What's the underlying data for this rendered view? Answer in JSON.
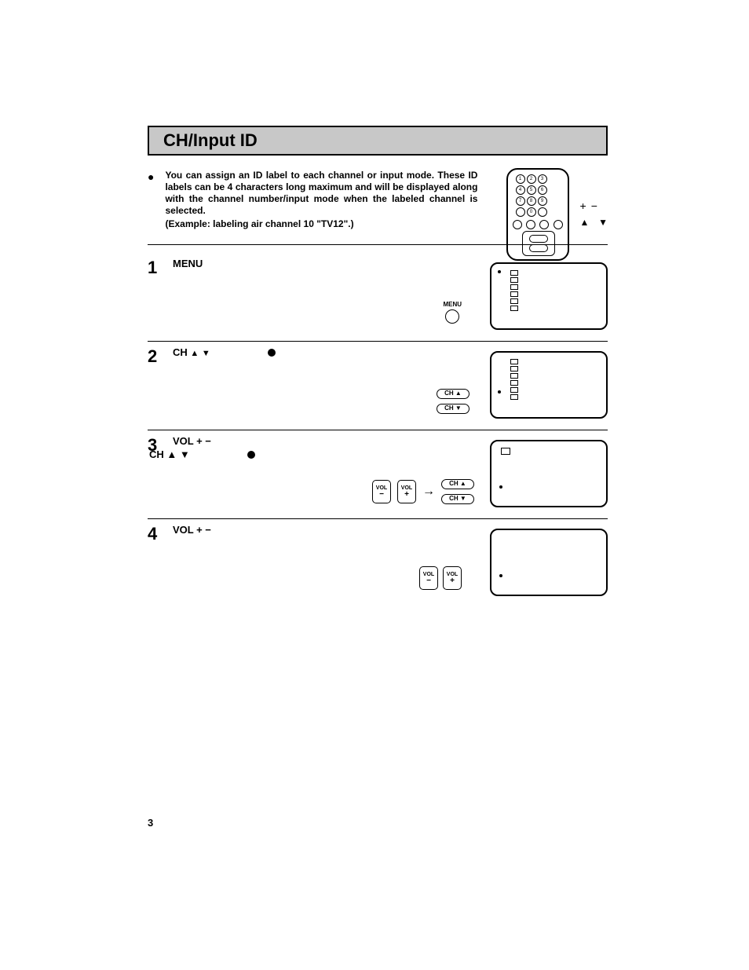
{
  "title": "CH/Input ID",
  "intro": "You can assign an ID label to each channel or input mode. These ID labels can be 4 characters long maximum and will be displayed along with the channel number/input mode when the labeled channel is selected.",
  "intro_example": "(Example: labeling air channel 10 \"TV12\".)",
  "remote_side": {
    "plus": "+",
    "minus": "−"
  },
  "steps": [
    {
      "num": "1",
      "label": "MENU",
      "menu_label": "MENU"
    },
    {
      "num": "2",
      "label_prefix": "CH",
      "ch_up": "CH ▲",
      "ch_down": "CH ▼"
    },
    {
      "num": "3",
      "label_prefix": "VOL  +  −",
      "sub_prefix": "CH",
      "vol": "VOL",
      "plus": "+",
      "minus": "−",
      "ch_up": "CH ▲",
      "ch_down": "CH ▼"
    },
    {
      "num": "4",
      "label_prefix": "VOL  +  −",
      "vol": "VOL",
      "plus": "+",
      "minus": "−"
    }
  ],
  "page_number": "3"
}
